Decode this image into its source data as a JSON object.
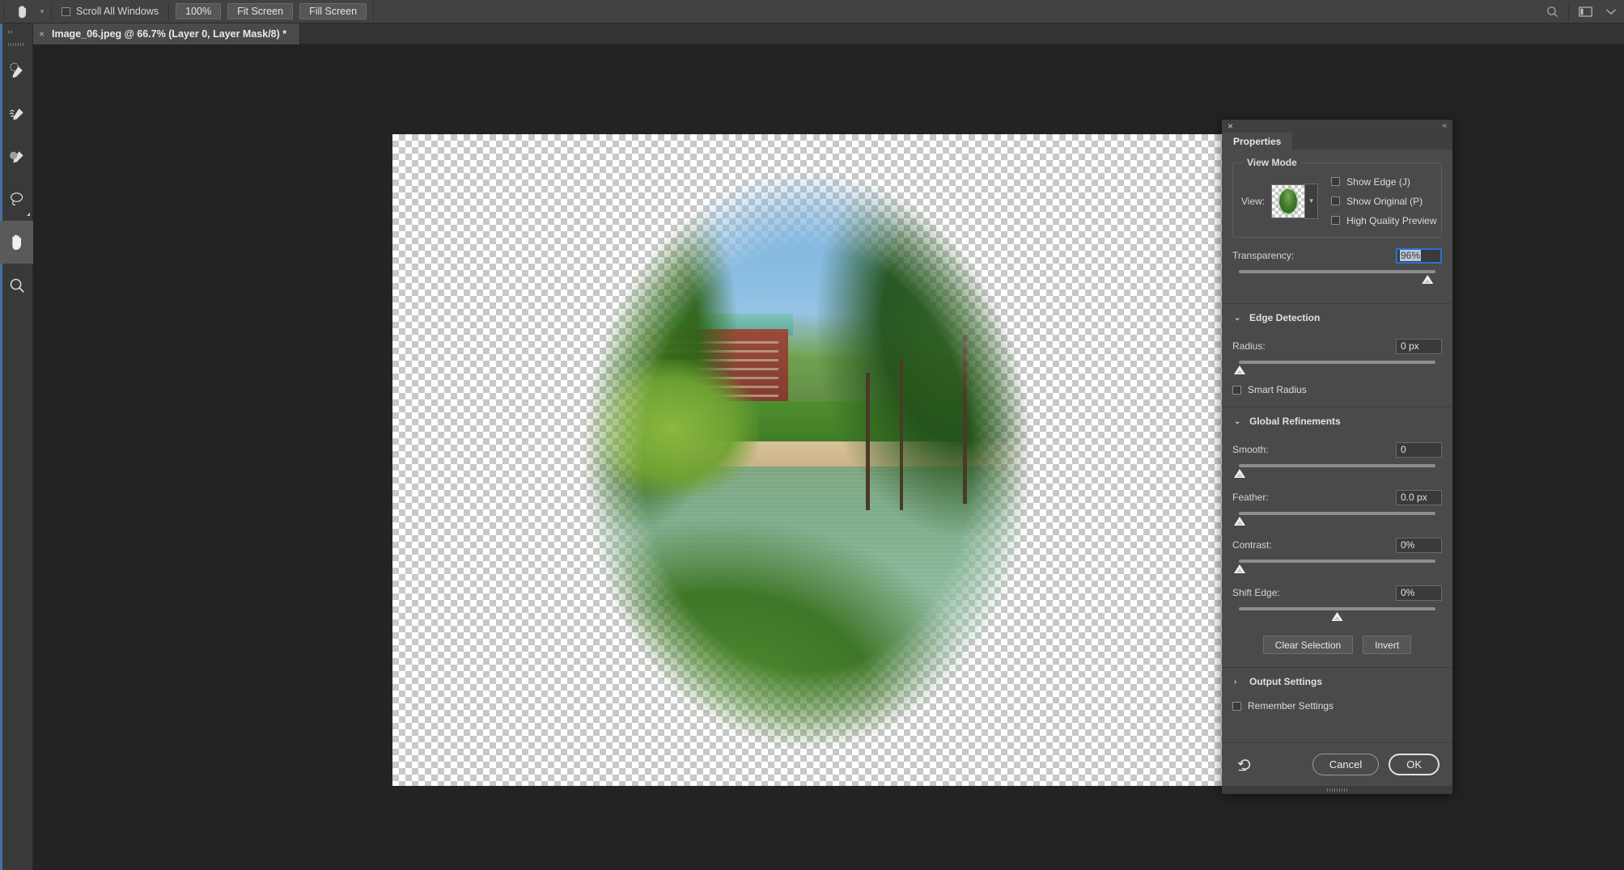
{
  "options_bar": {
    "active_tool_icon": "hand-tool-icon",
    "tool_dropdown_icon": "chevron-down-icon",
    "scroll_all_windows": {
      "label": "Scroll All Windows",
      "checked": false
    },
    "buttons": [
      {
        "id": "zoom-100",
        "label": "100%"
      },
      {
        "id": "fit-screen",
        "label": "Fit Screen"
      },
      {
        "id": "fill-screen",
        "label": "Fill Screen"
      }
    ],
    "right_icons": [
      {
        "id": "search-icon",
        "glyph": "search"
      },
      {
        "id": "workspace-icon",
        "glyph": "workspace"
      },
      {
        "id": "chevron-down-icon",
        "glyph": "chevron"
      }
    ]
  },
  "document_tab": {
    "close_glyph": "×",
    "title": "Image_06.jpeg @ 66.7% (Layer 0, Layer Mask/8) *"
  },
  "toolbar": {
    "expand_glyph": "››",
    "items": [
      {
        "name": "quick-selection-tool",
        "active": false
      },
      {
        "name": "refine-edge-brush-tool",
        "active": false
      },
      {
        "name": "brush-tool",
        "active": false
      },
      {
        "name": "lasso-tool",
        "active": false,
        "has_flyout": true
      },
      {
        "name": "hand-tool",
        "active": true
      },
      {
        "name": "zoom-tool",
        "active": false
      }
    ]
  },
  "canvas": {
    "zoom_label": "66.7%",
    "transparency_checker": true,
    "photo_description": "River scene with willow trees, sandy bank, grass, and a red brick building with a teal roof, masked into a feathered oval vignette"
  },
  "panel": {
    "close_glyph": "×",
    "collapse_glyph": "«",
    "tab_label": "Properties",
    "view_mode": {
      "legend": "View Mode",
      "view_label": "View:",
      "view_dropdown_icon": "chevron-down-icon",
      "checks": [
        {
          "id": "show-edge",
          "label": "Show Edge (J)",
          "checked": false
        },
        {
          "id": "show-original",
          "label": "Show Original (P)",
          "checked": false
        },
        {
          "id": "high-quality-preview",
          "label": "High Quality Preview",
          "checked": false
        }
      ],
      "transparency": {
        "label": "Transparency:",
        "value": "96%",
        "focused": true,
        "slider_percent": 96
      }
    },
    "edge_detection": {
      "title": "Edge Detection",
      "expanded": true,
      "twirl_glyph": "⌄",
      "radius": {
        "label": "Radius:",
        "value": "0 px",
        "slider_percent": 0
      },
      "smart_radius": {
        "label": "Smart Radius",
        "checked": false
      }
    },
    "global_refinements": {
      "title": "Global Refinements",
      "expanded": true,
      "twirl_glyph": "⌄",
      "sliders": [
        {
          "id": "smooth",
          "label": "Smooth:",
          "value": "0",
          "slider_percent": 0
        },
        {
          "id": "feather",
          "label": "Feather:",
          "value": "0.0 px",
          "slider_percent": 0
        },
        {
          "id": "contrast",
          "label": "Contrast:",
          "value": "0%",
          "slider_percent": 0
        },
        {
          "id": "shift-edge",
          "label": "Shift Edge:",
          "value": "0%",
          "slider_percent": 50
        }
      ],
      "buttons": [
        {
          "id": "clear-selection",
          "label": "Clear Selection"
        },
        {
          "id": "invert",
          "label": "Invert"
        }
      ]
    },
    "output_settings": {
      "title": "Output Settings",
      "expanded": false,
      "twirl_glyph": "›"
    },
    "remember_settings": {
      "label": "Remember Settings",
      "checked": false
    },
    "footer": {
      "reset_icon": "reset-arrow-icon",
      "cancel_label": "Cancel",
      "ok_label": "OK",
      "ok_is_default": true
    }
  },
  "colors": {
    "options_bar_bg": "#424242",
    "tabbar_bg": "#333333",
    "toolbar_bg": "#393939",
    "toolbar_accent": "#4a6f9e",
    "canvas_bg": "#232323",
    "panel_bg": "#4a4a4a",
    "panel_header_bg": "#3f3f3f",
    "field_bg": "#3a3a3a",
    "focus_blue": "#2f6fd0",
    "selection_highlight": "#b9c6da",
    "text_primary": "#e8e8e8",
    "text_secondary": "#d4d4d4",
    "slider_track": "#8d8d8d",
    "knob": "#f2f2f2"
  }
}
